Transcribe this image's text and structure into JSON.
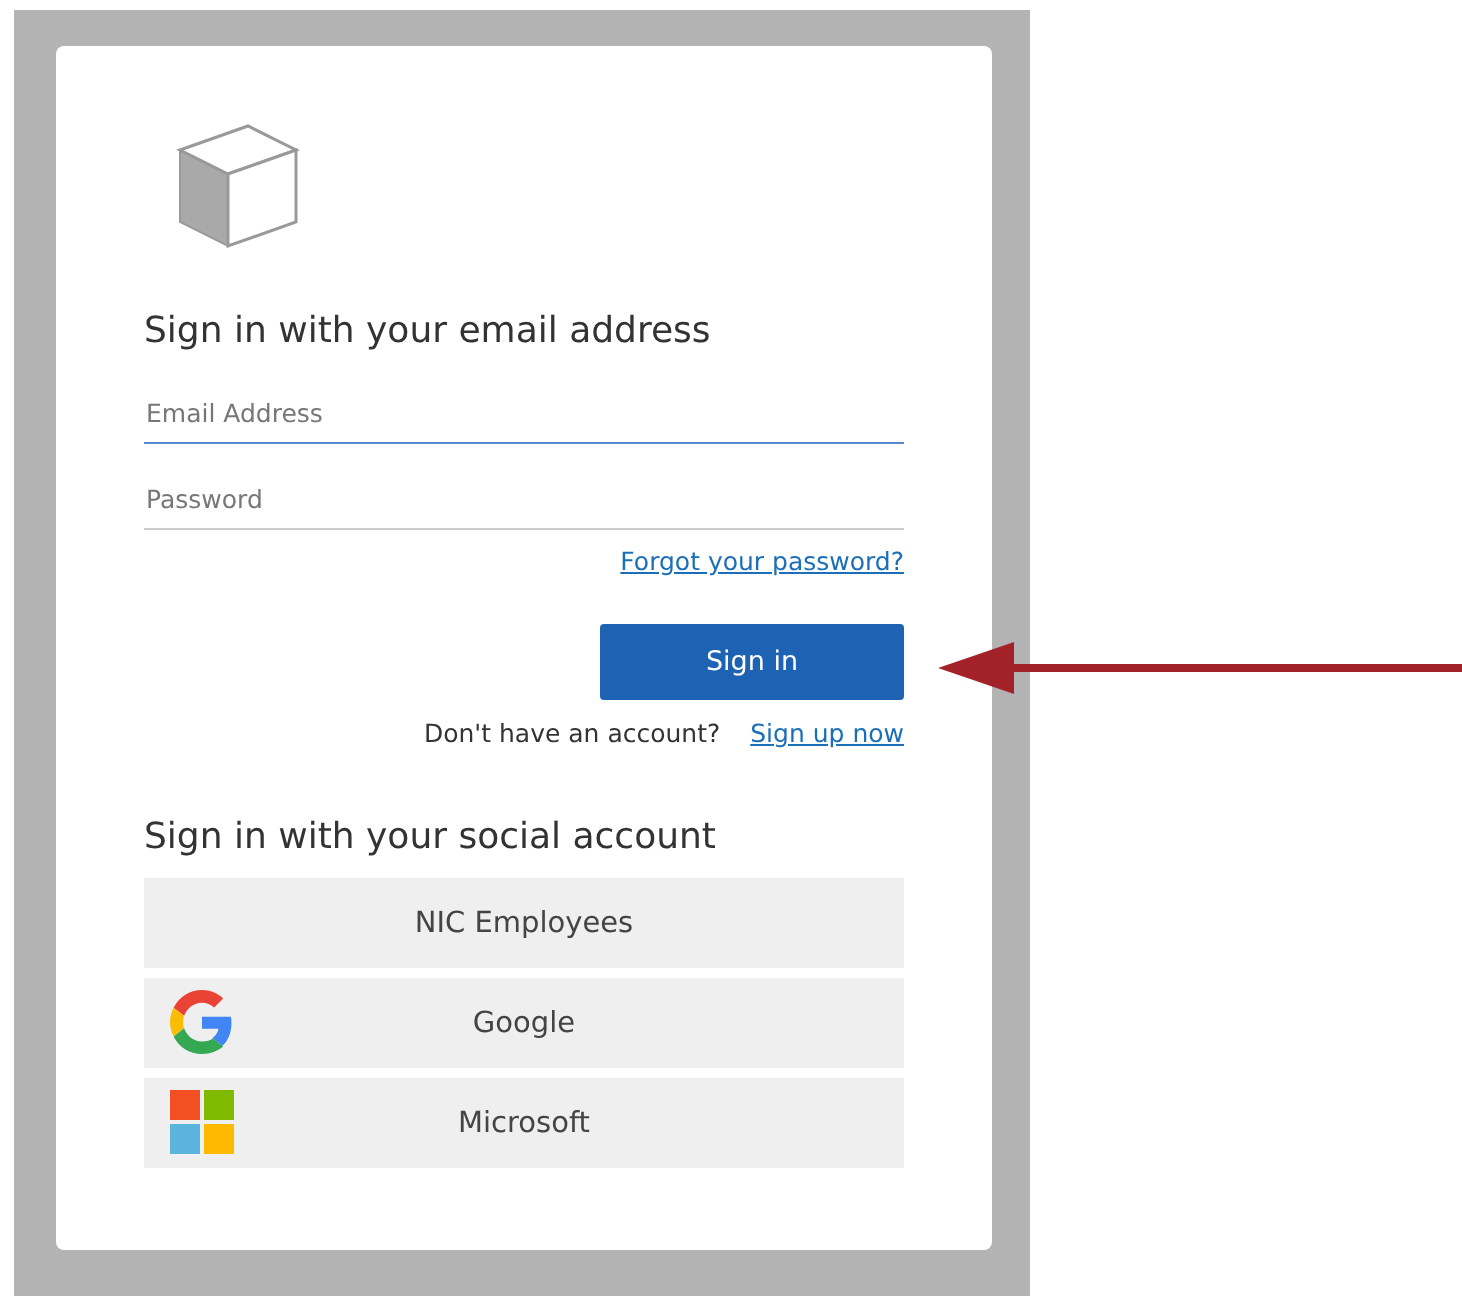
{
  "heading": "Sign in with your email address",
  "fields": [
    {
      "placeholder": "Email Address",
      "focused": true
    },
    {
      "placeholder": "Password",
      "focused": false
    }
  ],
  "forgot_link": "Forgot your password?",
  "sign_in_button": "Sign in",
  "signup_prompt": "Don't have an account?",
  "signup_link": "Sign up now",
  "social_heading": "Sign in with your social account",
  "social_buttons": [
    {
      "kind": "plain",
      "label": "NIC Employees"
    },
    {
      "kind": "google",
      "label": "Google"
    },
    {
      "kind": "microsoft",
      "label": "Microsoft"
    }
  ]
}
